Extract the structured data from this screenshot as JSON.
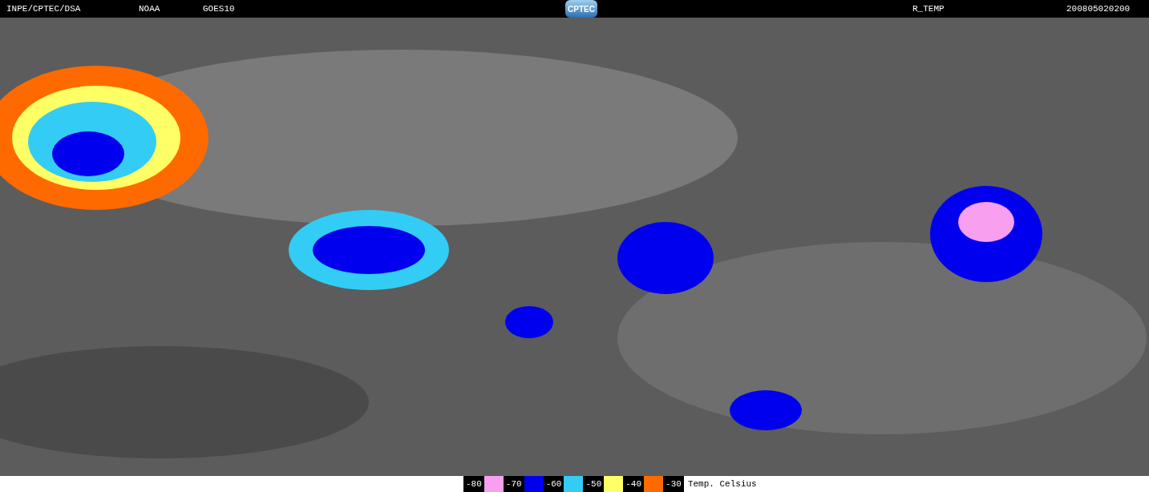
{
  "header": {
    "left": [
      "INPE/CPTEC/DSA",
      "NOAA",
      "GOES10"
    ],
    "logo": "CPTEC",
    "product": "R_TEMP",
    "timestamp": "200805020200"
  },
  "legend": {
    "items": [
      {
        "label": "-80",
        "color": "#f99ff0"
      },
      {
        "label": "-70",
        "color": "#0000ee"
      },
      {
        "label": "-60",
        "color": "#33ccf5"
      },
      {
        "label": "-50",
        "color": "#ffff66"
      },
      {
        "label": "-40",
        "color": "#ff6a00"
      }
    ],
    "last_label": "-30",
    "unit": "Temp. Celsius"
  }
}
